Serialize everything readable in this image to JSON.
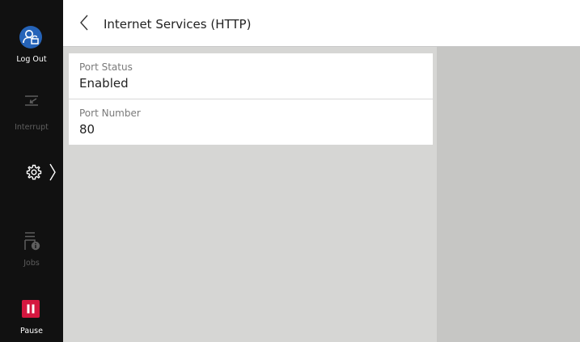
{
  "sidebar": {
    "logout_label": "Log Out",
    "interrupt_label": "Interrupt",
    "jobs_label": "Jobs",
    "pause_label": "Pause",
    "icons": {
      "logout": "user-logout-icon",
      "interrupt": "interrupt-icon",
      "settings": "gear-icon",
      "settings_chevron": "chevron-right-icon",
      "jobs": "jobs-icon",
      "pause": "pause-icon"
    },
    "colors": {
      "logout_accent": "#2563b8",
      "pause_accent": "#d5173f"
    }
  },
  "header": {
    "title": "Internet Services (HTTP)",
    "back_icon": "chevron-left-icon"
  },
  "settings": [
    {
      "label": "Port Status",
      "value": "Enabled"
    },
    {
      "label": "Port Number",
      "value": "80"
    }
  ]
}
